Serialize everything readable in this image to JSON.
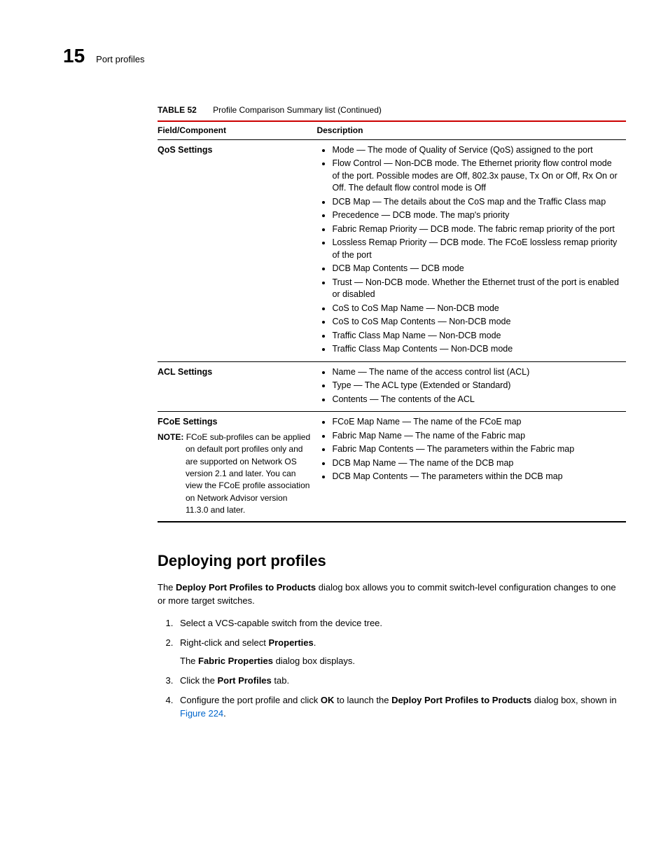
{
  "header": {
    "chapter_number": "15",
    "chapter_title": "Port profiles"
  },
  "table": {
    "caption_label": "TABLE 52",
    "caption_text": "Profile Comparison Summary list (Continued)",
    "headers": {
      "col1": "Field/Component",
      "col2": "Description"
    },
    "rows": [
      {
        "field": "QoS Settings",
        "note": "",
        "items": [
          "Mode — The mode of Quality of Service (QoS) assigned to the port",
          "Flow Control — Non-DCB mode. The Ethernet priority flow control mode of the port. Possible modes are Off, 802.3x pause, Tx On or Off, Rx On or Off. The default flow control mode is Off",
          "DCB Map — The details about the CoS map and the Traffic Class map",
          "Precedence — DCB mode. The map's priority",
          "Fabric Remap Priority — DCB mode. The fabric remap priority of the port",
          "Lossless Remap Priority — DCB mode. The FCoE lossless remap priority of the port",
          "DCB Map Contents — DCB mode",
          "Trust — Non-DCB mode. Whether the Ethernet trust of the port is enabled or disabled",
          "CoS to CoS Map Name — Non-DCB mode",
          "CoS to CoS Map Contents — Non-DCB mode",
          "Traffic Class Map Name — Non-DCB mode",
          "Traffic Class Map Contents — Non-DCB mode"
        ]
      },
      {
        "field": "ACL Settings",
        "note": "",
        "items": [
          "Name — The name of the access control list (ACL)",
          "Type — The ACL type (Extended or Standard)",
          "Contents — The contents of the ACL"
        ]
      },
      {
        "field": "FCoE Settings",
        "note_label": "NOTE:",
        "note": "FCoE sub-profiles can be applied on default port profiles only and are supported on Network OS version 2.1 and later. You can view the FCoE profile association on Network Advisor version 11.3.0 and later.",
        "items": [
          "FCoE Map Name — The name of the FCoE map",
          "Fabric Map Name — The name of the Fabric map",
          "Fabric Map Contents — The parameters within the Fabric map",
          "DCB Map Name — The name of the DCB map",
          "DCB Map Contents — The parameters within the DCB map"
        ]
      }
    ]
  },
  "section": {
    "heading": "Deploying port profiles",
    "intro_pre": "The ",
    "intro_bold1": "Deploy Port Profiles to Products",
    "intro_post": " dialog box allows you to commit switch-level configuration changes to one or more target switches.",
    "steps": {
      "s1": "Select a VCS-capable switch from the device tree.",
      "s2_pre": "Right-click and select ",
      "s2_bold": "Properties",
      "s2_post": ".",
      "s2_sub_pre": "The ",
      "s2_sub_bold": "Fabric Properties",
      "s2_sub_post": " dialog box displays.",
      "s3_pre": "Click the ",
      "s3_bold": "Port Profiles",
      "s3_post": " tab.",
      "s4_pre": "Configure the port profile and click ",
      "s4_bold1": "OK",
      "s4_mid": " to launch the ",
      "s4_bold2": "Deploy Port Profiles to Products",
      "s4_post": " dialog box, shown in ",
      "s4_link": "Figure 224",
      "s4_end": "."
    }
  }
}
